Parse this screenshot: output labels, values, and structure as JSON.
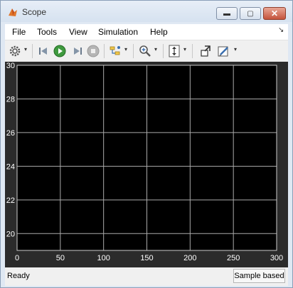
{
  "window": {
    "title": "Scope"
  },
  "menu": {
    "items": [
      "File",
      "Tools",
      "View",
      "Simulation",
      "Help"
    ]
  },
  "toolbar": {
    "icons": [
      "gear-icon",
      "step-back-icon",
      "play-icon",
      "step-forward-icon",
      "stop-icon",
      "signal-selector-icon",
      "zoom-icon",
      "autoscale-icon",
      "highlight-block-icon",
      "edit-icon"
    ]
  },
  "status": {
    "left": "Ready",
    "right": "Sample based"
  },
  "colors": {
    "plot_background": "#000000",
    "grid": "#aaaaaa",
    "axis_text": "#ffffff",
    "frame": "#2b2b2b"
  },
  "chart_data": {
    "type": "line",
    "title": "",
    "xlabel": "",
    "ylabel": "",
    "xlim": [
      0,
      300
    ],
    "ylim": [
      19,
      30
    ],
    "x_ticks": [
      "0",
      "50",
      "100",
      "150",
      "200",
      "250",
      "300"
    ],
    "y_ticks": [
      "20",
      "22",
      "24",
      "26",
      "28",
      "30"
    ],
    "grid": true,
    "series": []
  }
}
